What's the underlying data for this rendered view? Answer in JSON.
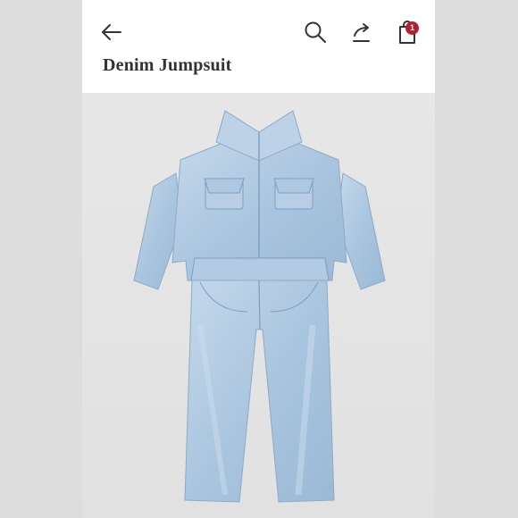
{
  "header": {
    "title": "Denim Jumpsuit",
    "bag_count": "1",
    "icons": [
      "back-arrow-icon",
      "search-icon",
      "share-icon",
      "shopping-bag-icon"
    ]
  },
  "product": {
    "image": "denim-jumpsuit-photo",
    "colors": {
      "denim": "#a9c5df",
      "denim_light": "#c3d7ea",
      "badge": "#b21f2d"
    }
  }
}
